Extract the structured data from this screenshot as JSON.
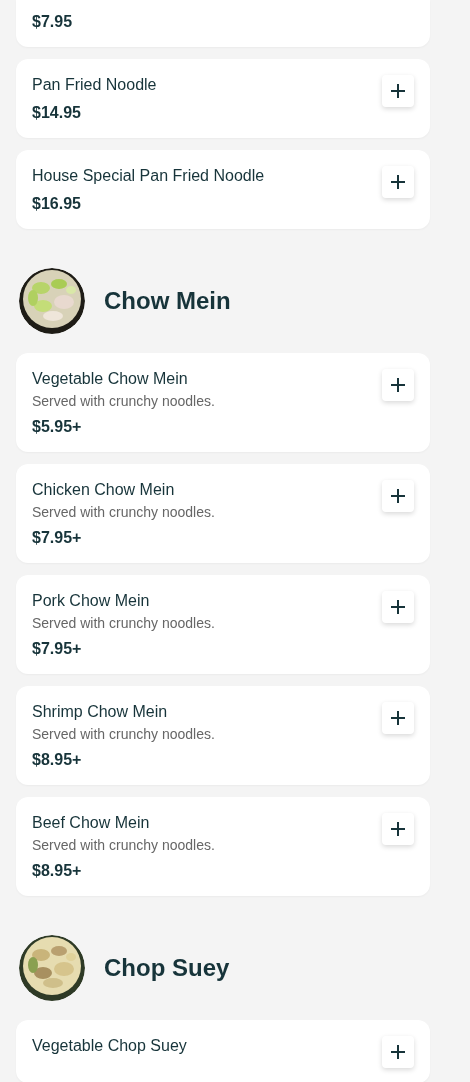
{
  "sections": [
    {
      "items": [
        {
          "price": "$7.95"
        },
        {
          "name": "Pan Fried Noodle",
          "price": "$14.95"
        },
        {
          "name": "House Special Pan Fried Noodle",
          "price": "$16.95"
        }
      ]
    },
    {
      "title": "Chow Mein",
      "items": [
        {
          "name": "Vegetable Chow Mein",
          "description": "Served with crunchy noodles.",
          "price": "$5.95+"
        },
        {
          "name": "Chicken Chow Mein",
          "description": "Served with crunchy noodles.",
          "price": "$7.95+"
        },
        {
          "name": "Pork Chow Mein",
          "description": "Served with crunchy noodles.",
          "price": "$7.95+"
        },
        {
          "name": "Shrimp Chow Mein",
          "description": "Served with crunchy noodles.",
          "price": "$8.95+"
        },
        {
          "name": "Beef Chow Mein",
          "description": "Served with crunchy noodles.",
          "price": "$8.95+"
        }
      ]
    },
    {
      "title": "Chop Suey",
      "items": [
        {
          "name": "Vegetable Chop Suey"
        }
      ]
    }
  ]
}
